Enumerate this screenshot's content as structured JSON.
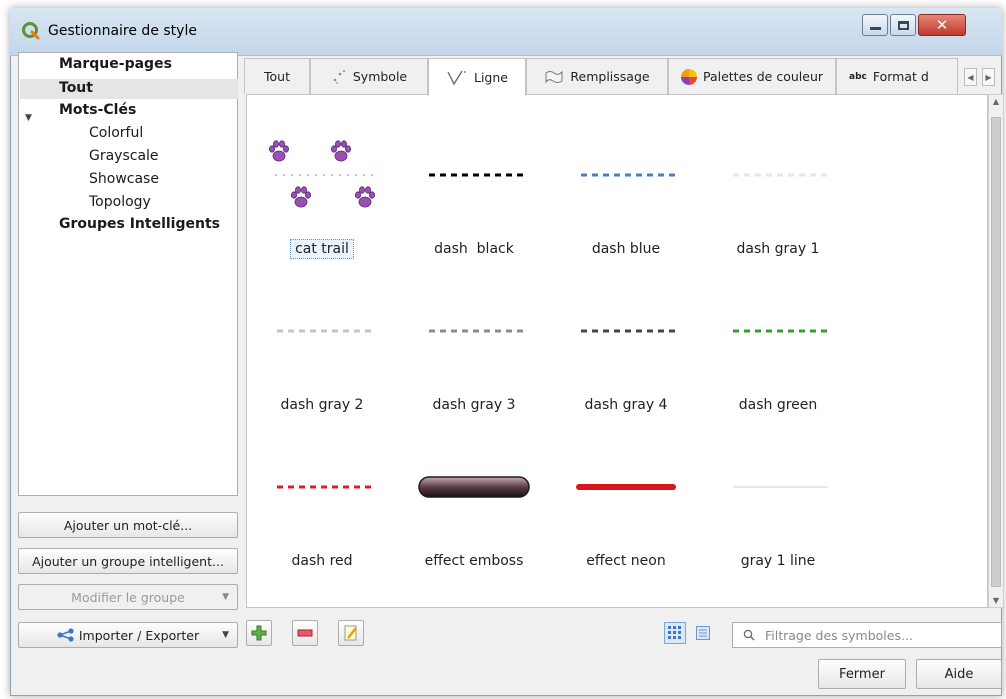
{
  "window": {
    "title": "Gestionnaire de style"
  },
  "tree": {
    "items": [
      {
        "label": "Marque-pages"
      },
      {
        "label": "Tout"
      },
      {
        "label": "Mots-Clés"
      },
      {
        "label": "Colorful"
      },
      {
        "label": "Grayscale"
      },
      {
        "label": "Showcase"
      },
      {
        "label": "Topology"
      },
      {
        "label": "Groupes Intelligents"
      }
    ],
    "selected": "Tout"
  },
  "left_buttons": {
    "add_tag": "Ajouter un mot-clé...",
    "add_smart_group": "Ajouter un groupe intelligent...",
    "modify_group": "Modifier le groupe",
    "import_export": "Importer / Exporter"
  },
  "tabs": [
    {
      "label": "Tout",
      "icon": "none"
    },
    {
      "label": "Symbole",
      "icon": "marker-icon"
    },
    {
      "label": "Ligne",
      "icon": "line-icon"
    },
    {
      "label": "Remplissage",
      "icon": "fill-icon"
    },
    {
      "label": "Palettes de couleur",
      "icon": "color-wheel-icon"
    },
    {
      "label": "Format d",
      "icon": "text-format-icon",
      "icon_text": "abc"
    }
  ],
  "active_tab": "Ligne",
  "symbols": [
    {
      "name": "cat trail",
      "style": "paws",
      "color": "#9b4fb5",
      "selected": true
    },
    {
      "name": "dash  black",
      "style": "dash",
      "color": "#000000"
    },
    {
      "name": "dash blue",
      "style": "dash",
      "color": "#4a7fc1"
    },
    {
      "name": "dash gray 1",
      "style": "dash",
      "color": "#e6e6e6"
    },
    {
      "name": "dash gray 2",
      "style": "dash",
      "color": "#c4c4c4"
    },
    {
      "name": "dash gray 3",
      "style": "dash",
      "color": "#8c8c8c"
    },
    {
      "name": "dash gray 4",
      "style": "dash",
      "color": "#444444"
    },
    {
      "name": "dash green",
      "style": "dash",
      "color": "#33a02c"
    },
    {
      "name": "dash red",
      "style": "dash",
      "color": "#d42030"
    },
    {
      "name": "effect emboss",
      "style": "emboss",
      "color": "#5a3e45"
    },
    {
      "name": "effect neon",
      "style": "neon",
      "color": "#d8141c"
    },
    {
      "name": "gray 1 line",
      "style": "solid",
      "color": "#e8e8e8"
    }
  ],
  "filter": {
    "placeholder": "Filtrage des symboles..."
  },
  "dialog_buttons": {
    "close": "Fermer",
    "help": "Aide"
  }
}
